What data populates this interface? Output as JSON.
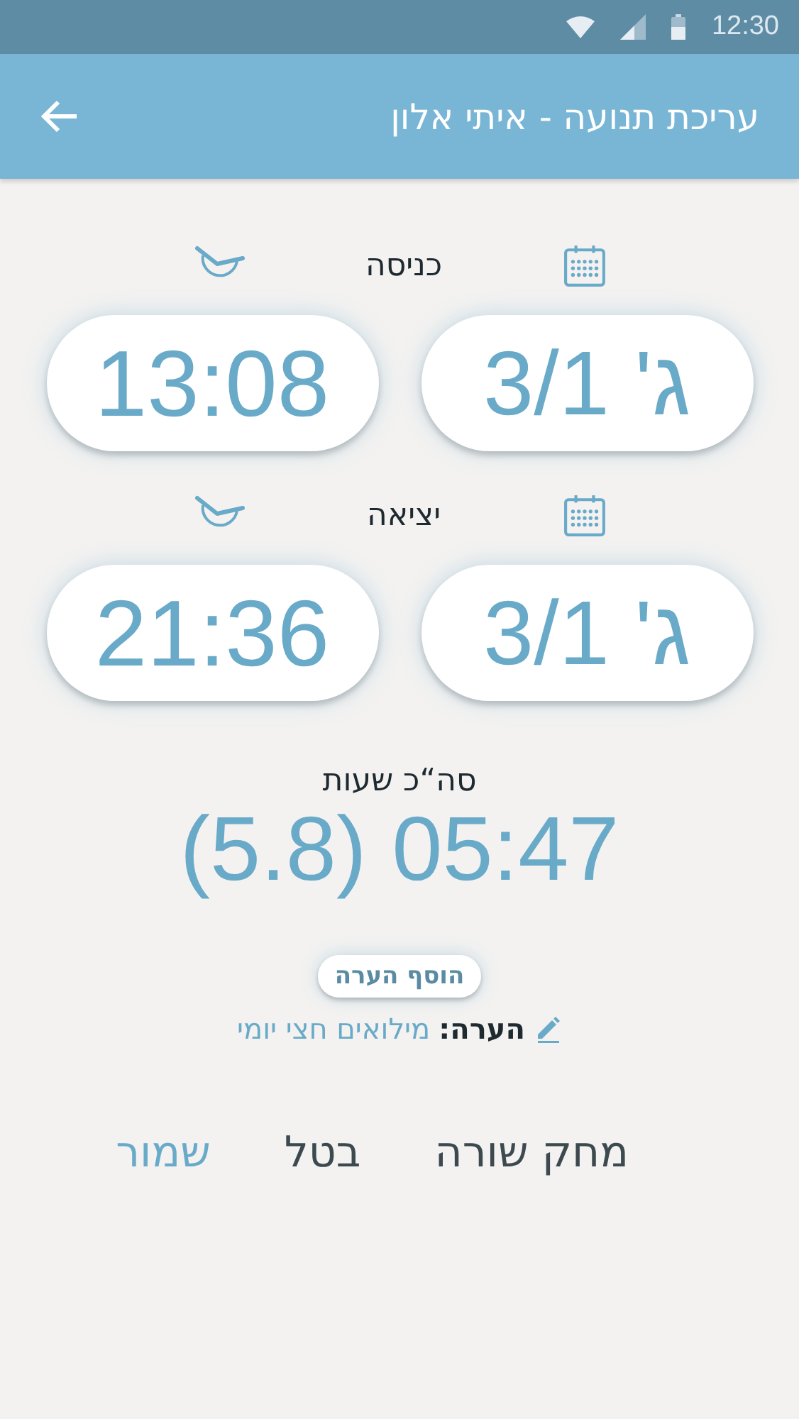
{
  "status_bar": {
    "time": "12:30"
  },
  "app_bar": {
    "title": "עריכת תנועה - איתי אלון"
  },
  "sections": [
    {
      "label": "כניסה",
      "date": "ג' 3/1",
      "time": "13:08"
    },
    {
      "label": "יציאה",
      "date": "ג' 3/1",
      "time": "21:36"
    }
  ],
  "total": {
    "label": "סה“כ שעות",
    "value": "(5.8) 05:47"
  },
  "add_note_button": "הוסף הערה",
  "note": {
    "label": "הערה:",
    "value": "מילואים חצי יומי"
  },
  "actions": [
    {
      "label": "מחק שורה",
      "kind": "plain"
    },
    {
      "label": "בטל",
      "kind": "plain"
    },
    {
      "label": "שמור",
      "kind": "primary"
    }
  ]
}
